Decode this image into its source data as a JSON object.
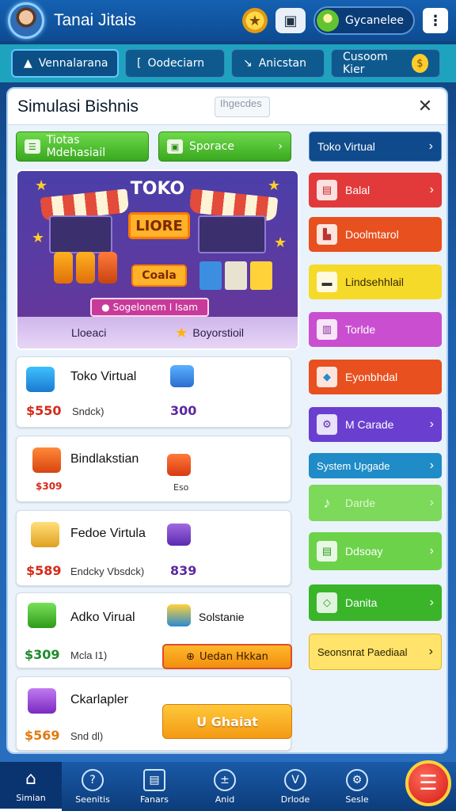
{
  "header": {
    "title": "Tanai Jitais",
    "user_label": "Gycanelee"
  },
  "tabs": [
    {
      "label": "Vennalarana"
    },
    {
      "label": "Oodeciarn"
    },
    {
      "label": "Anicstan"
    },
    {
      "label": "Cusoom Kier",
      "badge": "$"
    }
  ],
  "panel": {
    "title": "Simulasi Bishnis",
    "search_placeholder": "Ihgecdes",
    "close": "✕",
    "chips": [
      {
        "label": "Tiotas Mdehasiail"
      },
      {
        "label": "Sporace",
        "chevron": "›"
      }
    ],
    "hero": {
      "title": "TOKO",
      "sign_big": "LIORE",
      "sign_small": "Coala",
      "ribbon": "Sogelonem I Isam",
      "footer_left": "Lloeaci",
      "footer_right": "Boyorstioil"
    },
    "products": [
      {
        "name": "Toko Virtual",
        "price": "$550",
        "sub": "Sndck)",
        "num": "300",
        "price_color": "#d62a1a"
      },
      {
        "name": "Bindlakstian",
        "price": "$309",
        "sub": "",
        "num": "Eso",
        "price_color": "#d62a1a"
      },
      {
        "name": "Fedoe Virtula",
        "price": "$589",
        "sub": "Endcky Vbsdck)",
        "num": "839",
        "price_color": "#d62a1a"
      },
      {
        "name": "Adko Virual",
        "price": "$309",
        "sub": "Mcla I1)",
        "right_label": "Solstanie",
        "button": "Uedan Hkkan",
        "price_color": "#1f8a2a"
      },
      {
        "name": "Ckarlapler",
        "price": "$569",
        "sub": "Snd dl)",
        "button": "U Ghaiat",
        "price_color": "#e07a10"
      }
    ],
    "side_actions": [
      {
        "label": "Toko Virtual",
        "color": "#0f4a8c"
      },
      {
        "label": "Balal",
        "color": "#e23a3a"
      },
      {
        "label": "Doolmtarol",
        "color": "#e8501f"
      },
      {
        "label": "Lindsehhlail",
        "color": "#f5da2a"
      },
      {
        "label": "Torlde",
        "color": "#c94fd0"
      },
      {
        "label": "Eyonbhdal",
        "color": "#e8501f"
      },
      {
        "label": "M Carade",
        "color": "#6a3fd0"
      },
      {
        "label": "System Upgade",
        "color": "#1f8cc8"
      },
      {
        "label": "Darde",
        "color": "#7cd95a"
      },
      {
        "label": "Ddsoay",
        "color": "#6cd24a"
      },
      {
        "label": "Danita",
        "color": "#3ab52a"
      },
      {
        "label": "Seonsnrat Paediaal",
        "color": "#ffe36a"
      }
    ]
  },
  "bottom_nav": [
    {
      "label": "Simian",
      "icon": "home-icon"
    },
    {
      "label": "Seenitis",
      "icon": "chat-icon"
    },
    {
      "label": "Fanars",
      "icon": "clipboard-icon"
    },
    {
      "label": "Anid",
      "icon": "plus-icon"
    },
    {
      "label": "Drlode",
      "icon": "v-icon"
    },
    {
      "label": "Sesle",
      "icon": "gear-icon"
    }
  ]
}
